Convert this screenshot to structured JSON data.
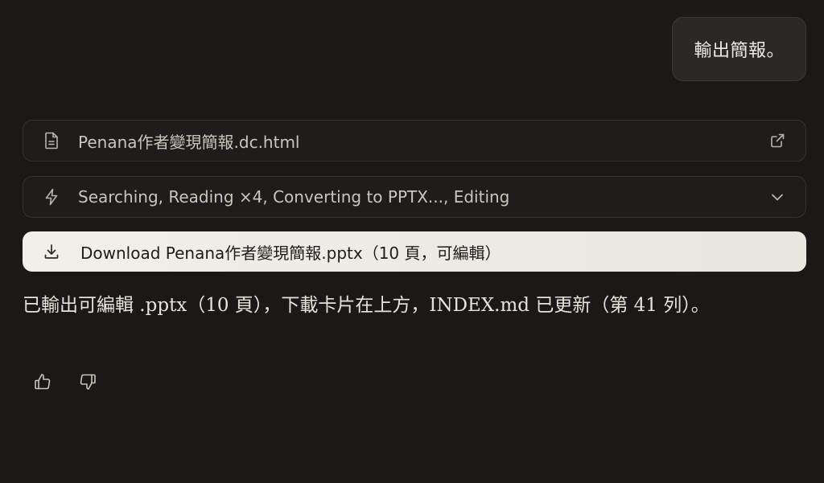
{
  "user_message": {
    "text": "輸出簡報。"
  },
  "file_card": {
    "icon": "document-icon",
    "filename": "Penana作者變現簡報.dc.html",
    "trail_icon": "external-link-icon"
  },
  "steps_card": {
    "icon": "lightning-icon",
    "summary": "Searching, Reading ×4, Converting to PPTX..., Editing",
    "trail_icon": "chevron-down-icon"
  },
  "download": {
    "icon": "download-icon",
    "label": "Download Penana作者變現簡報.pptx（10 頁，可編輯）"
  },
  "reply": {
    "text": "已輸出可編輯 .pptx（10 頁），下載卡片在上方，INDEX.md 已更新（第 41 列）。"
  },
  "feedback": {
    "thumbs_up_icon": "thumbs-up-icon",
    "thumbs_down_icon": "thumbs-down-icon"
  },
  "colors": {
    "background": "#1a1918",
    "card_border": "#34332f",
    "download_bg": "#f1efea"
  }
}
